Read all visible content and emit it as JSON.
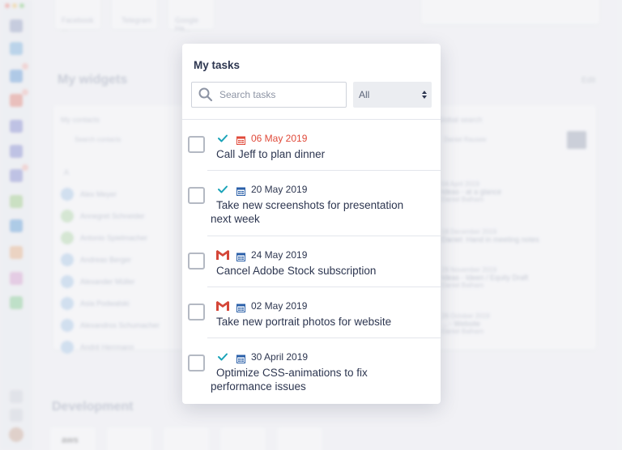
{
  "background": {
    "apps": [
      {
        "label": "Facebook ..."
      },
      {
        "label": "Telegram"
      },
      {
        "label": "Google Ha..."
      }
    ],
    "widgets_title": "My widgets",
    "edit_label": "Edit",
    "contacts": {
      "title": "My contacts",
      "search_placeholder": "Search contacts",
      "letter": "A",
      "people": [
        "Alex Meyer",
        "Annegret Schneider",
        "Antonio Spielmacher",
        "Andreas Berger",
        "Alexander Müller",
        "Asia Podwalski",
        "Alexandros Schumacher",
        "André Herrmann"
      ]
    },
    "global_search": {
      "title": "Global search",
      "query": "Daniel Rausee",
      "results": [
        {
          "date": "04 April 2019",
          "title": "Ideas - at a glance",
          "sub": "Daniel Balham"
        },
        {
          "date": "18 December 2019",
          "title": "Daniel: Hand in meeting notes",
          "sub": ""
        },
        {
          "date": "29 November 2019",
          "title": "Ideas - Ideen / Equity Draft",
          "sub": "Daniel Balham"
        },
        {
          "date": "26 October 2019",
          "title": "... - Website",
          "sub": "Daniel Balham"
        }
      ]
    },
    "development_title": "Development",
    "dev_logos": [
      "aws"
    ],
    "colors": {
      "sidebar": "#eceef2",
      "accent": "#3a7bd5"
    }
  },
  "modal": {
    "title": "My tasks",
    "search_placeholder": "Search tasks",
    "filter_value": "All",
    "tasks": [
      {
        "date": "06 May 2019",
        "overdue": true,
        "source": "check",
        "title_lines": [
          "Call Jeff to plan dinner"
        ]
      },
      {
        "date": "20 May 2019",
        "overdue": false,
        "source": "check",
        "title_lines": [
          "Take new screenshots for presentation",
          "next week"
        ]
      },
      {
        "date": "24 May 2019",
        "overdue": false,
        "source": "gmail",
        "title_lines": [
          "Cancel Adobe Stock subscription"
        ]
      },
      {
        "date": "02 May 2019",
        "overdue": false,
        "source": "gmail",
        "title_lines": [
          "Take new portrait photos for website"
        ]
      },
      {
        "date": "30 April 2019",
        "overdue": false,
        "source": "check",
        "title_lines": [
          "Optimize CSS-animations to fix",
          "performance issues"
        ]
      }
    ],
    "colors": {
      "overdue": "#e04a3a",
      "text": "#2d3650",
      "check": "#1aa3b8",
      "gmail": "#d44638",
      "calendar": "#2a5fa8"
    }
  }
}
